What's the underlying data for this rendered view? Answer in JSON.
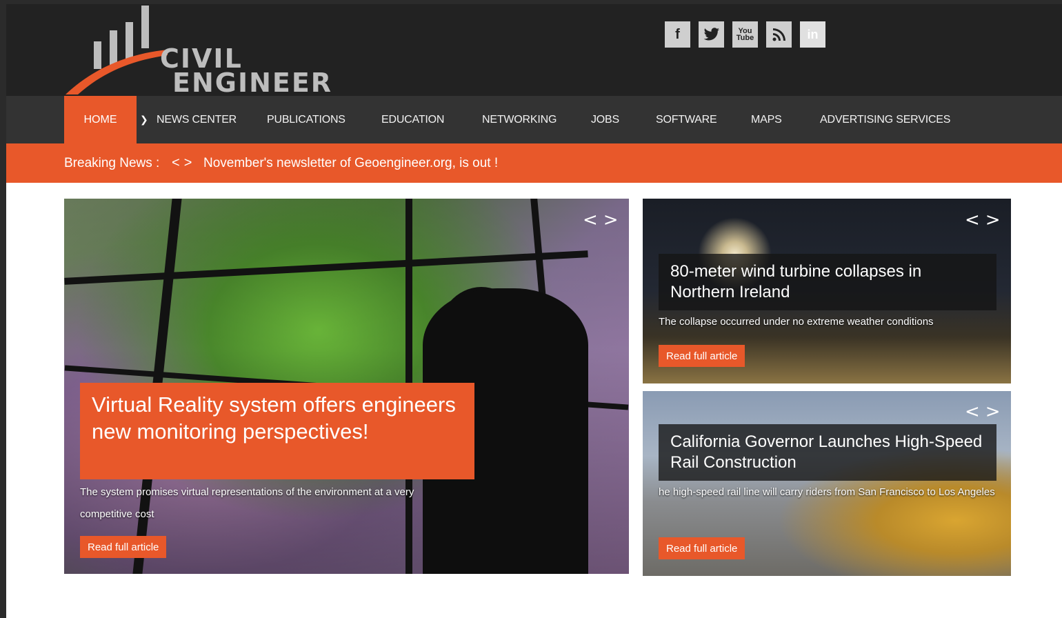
{
  "brand": {
    "line1": "CIVIL",
    "line2": "ENGINEER"
  },
  "social": [
    {
      "name": "facebook-icon",
      "glyph": "f"
    },
    {
      "name": "twitter-icon",
      "glyph": "🐦"
    },
    {
      "name": "youtube-icon",
      "glyph": "You Tube"
    },
    {
      "name": "rss-icon",
      "glyph": "◔"
    },
    {
      "name": "linkedin-icon",
      "glyph": "in"
    }
  ],
  "nav": {
    "home": "HOME",
    "items": [
      "NEWS CENTER",
      "PUBLICATIONS",
      "EDUCATION",
      "NETWORKING",
      "JOBS",
      "SOFTWARE",
      "MAPS",
      "ADVERTISING SERVICES"
    ]
  },
  "breaking": {
    "label": "Breaking News :",
    "prev": "<",
    "next": ">",
    "text": "November's newsletter of Geoengineer.org, is out !"
  },
  "featured": {
    "title": "Virtual Reality system offers engineers new monitoring perspectives!",
    "description": "The system promises virtual representations of the environment at a very competitive cost",
    "read_more": "Read full article"
  },
  "side_articles": [
    {
      "title": "80-meter wind turbine collapses in Northern Ireland",
      "description": "The collapse occurred under no extreme weather conditions",
      "read_more": "Read full article"
    },
    {
      "title": "California Governor Launches High-Speed Rail Construction",
      "description": "he high-speed rail line will carry riders from San Francisco to Los Angeles",
      "read_more": "Read full article"
    }
  ],
  "carousel": {
    "prev": "<",
    "next": ">"
  },
  "colors": {
    "accent": "#e8582a",
    "header": "#222222",
    "nav": "#333333"
  }
}
